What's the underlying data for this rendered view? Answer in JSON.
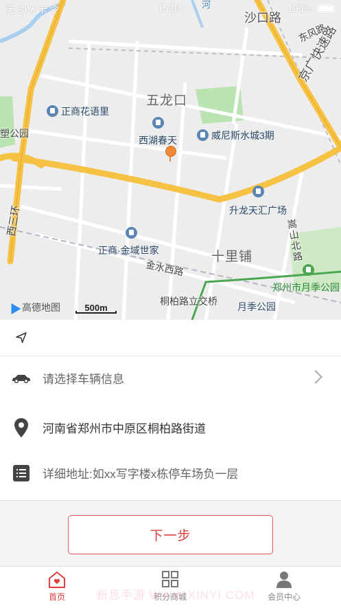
{
  "status_bar": {
    "carrier": "无 SIM 卡 令",
    "time": "15:04",
    "battery": "100%"
  },
  "map": {
    "labels": {
      "shakou_road": "沙口路",
      "dongfeng_road": "东风路",
      "jingguang_expressway": "京广快速路",
      "wulongkou": "五龙口",
      "zhengshang_huayuli": "正商花语里",
      "xihu_chuntian": "西湖春天",
      "weinisi": "威尼斯水城3期",
      "shenglong": "升龙天汇广场",
      "zhengshang_jinyu": "正商·金域世家",
      "shilipu": "十里铺",
      "jinshui_west": "金水西路",
      "songshan_north": "嵩山北路",
      "tongbai_bridge": "桐柏路立交桥",
      "yueji_park": "月季公园",
      "zhengzhou_yueji": "郑州市月季公园",
      "xisanhuan": "西三环",
      "park_partial": "塑公园",
      "river": "河"
    },
    "logo": "高德地图",
    "scale": "500m"
  },
  "form": {
    "vehicle_placeholder": "请选择车辆信息",
    "address": "河南省郑州市中原区桐柏路街道",
    "detail_placeholder": "详细地址:如xx写字楼x栋停车场负一层"
  },
  "actions": {
    "next_label": "下一步"
  },
  "tabs": [
    {
      "label": "首页",
      "icon": "home-icon",
      "active": true
    },
    {
      "label": "积分商城",
      "icon": "grid-icon",
      "active": false
    },
    {
      "label": "会员中心",
      "icon": "user-icon",
      "active": false
    }
  ],
  "watermark": "新息手游 WWW.XINYI.COM",
  "colors": {
    "accent": "#e23c3c",
    "road_major": "#f6c244",
    "park": "#a8dea0",
    "map_bg": "#ededed"
  }
}
